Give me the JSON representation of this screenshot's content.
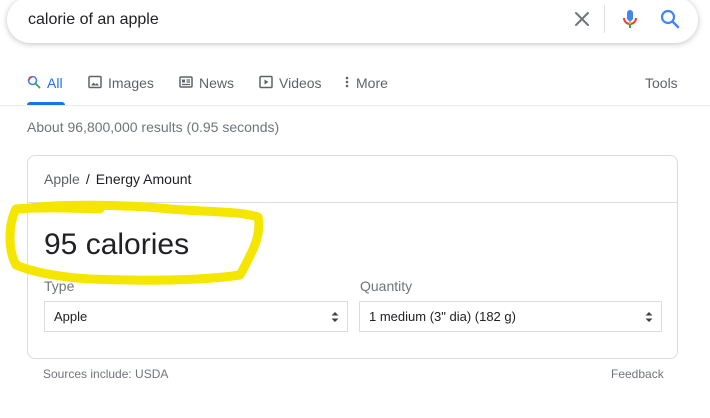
{
  "search": {
    "query": "calorie of an apple"
  },
  "icons": {
    "clear": "close-icon",
    "voice": "mic-icon",
    "search": "search-icon"
  },
  "tabs": [
    {
      "label": "All",
      "icon": "search-icon",
      "active": true
    },
    {
      "label": "Images",
      "icon": "image-icon"
    },
    {
      "label": "News",
      "icon": "news-icon"
    },
    {
      "label": "Videos",
      "icon": "video-icon"
    },
    {
      "label": "More",
      "icon": "more-vert-icon"
    }
  ],
  "tools_label": "Tools",
  "result_stats": "About 96,800,000 results (0.95 seconds)",
  "card": {
    "breadcrumb": {
      "parent": "Apple",
      "separator": "/",
      "current": "Energy Amount"
    },
    "value": "95 calories",
    "type_label": "Type",
    "type_value": "Apple",
    "quantity_label": "Quantity",
    "quantity_value": "1 medium (3\" dia) (182 g)"
  },
  "sources": "Sources include: USDA",
  "feedback": "Feedback",
  "colors": {
    "accent": "#1a73e8",
    "highlight": "#f5e600",
    "mic_red": "#ea4335"
  }
}
